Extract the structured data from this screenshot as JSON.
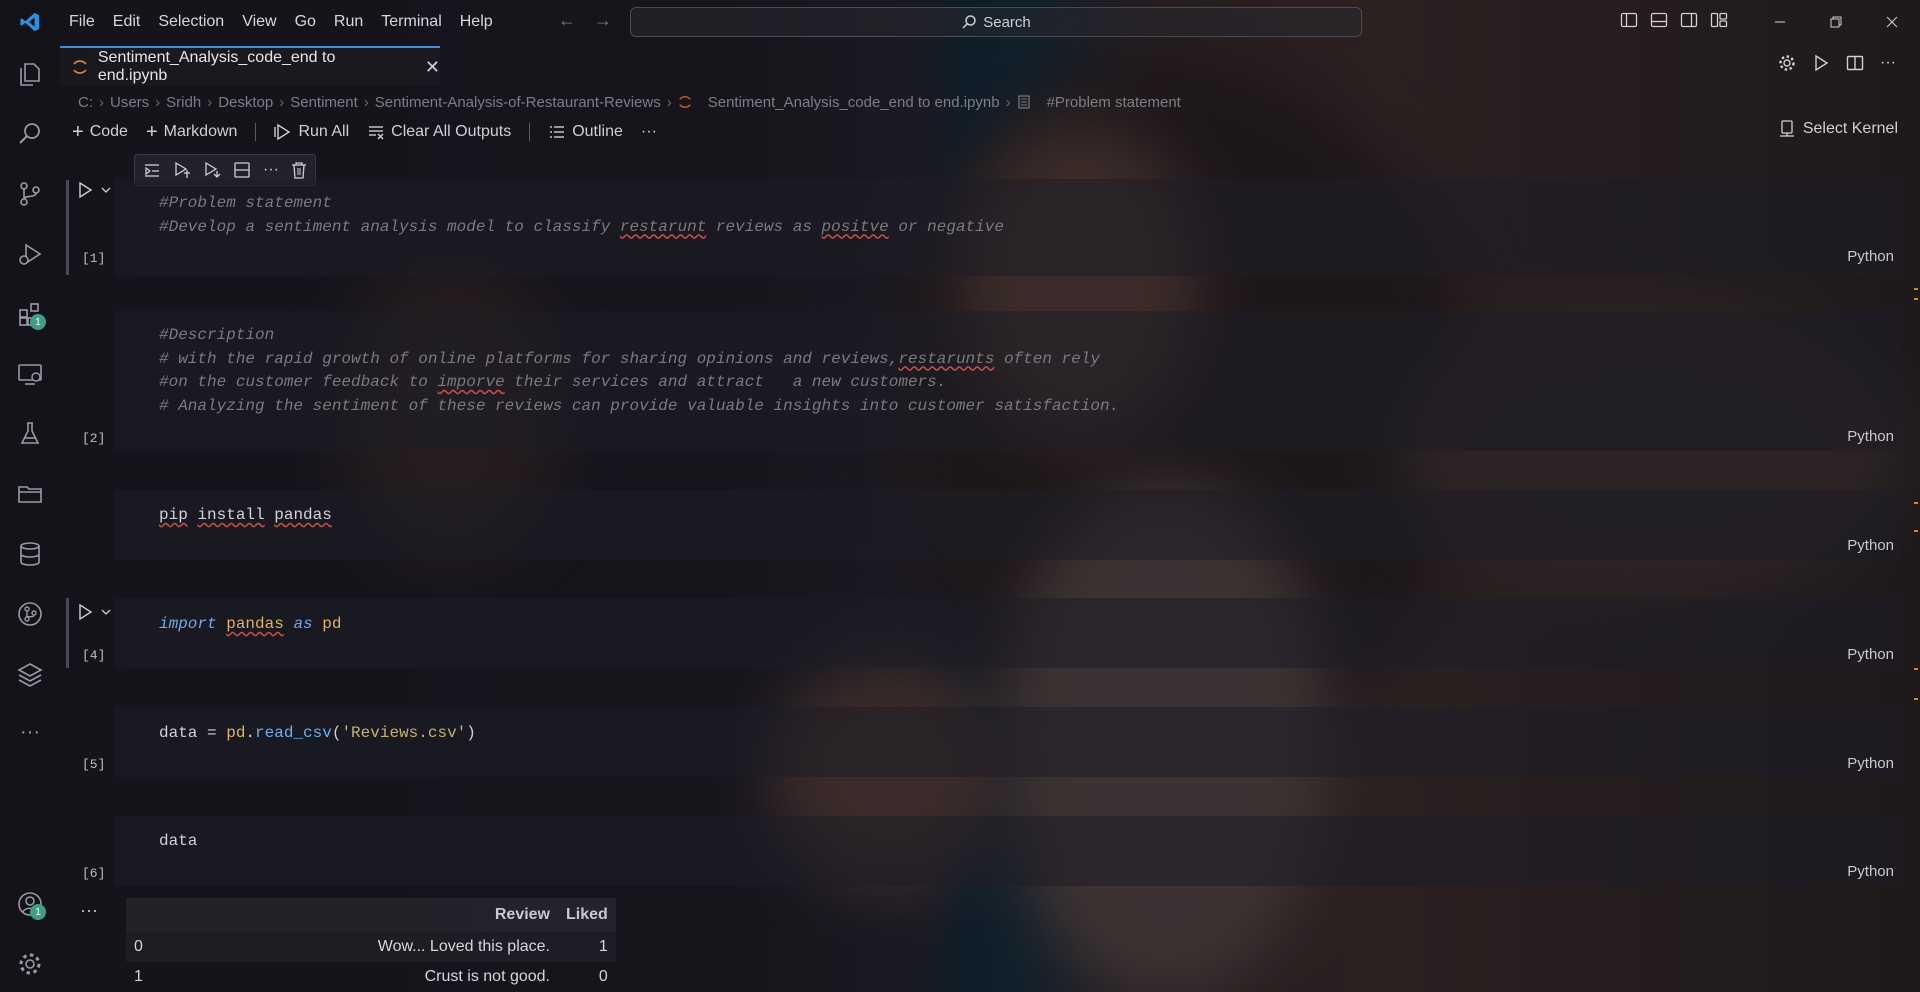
{
  "menu": [
    "File",
    "Edit",
    "Selection",
    "View",
    "Go",
    "Run",
    "Terminal",
    "Help"
  ],
  "search": {
    "placeholder": "Search"
  },
  "activity_badges": {
    "extensions": "1",
    "accounts": "1"
  },
  "tab": {
    "label": "Sentiment_Analysis_code_end to end.ipynb"
  },
  "breadcrumb": [
    "C:",
    "Users",
    "Sridh",
    "Desktop",
    "Sentiment",
    "Sentiment-Analysis-of-Restaurant-Reviews",
    "Sentiment_Analysis_code_end to end.ipynb",
    "#Problem statement"
  ],
  "toolbar": {
    "code": "Code",
    "markdown": "Markdown",
    "run_all": "Run All",
    "clear_outputs": "Clear All Outputs",
    "outline": "Outline",
    "more": "···",
    "kernel": "Select Kernel"
  },
  "cells": [
    {
      "exec": "[1]",
      "lang": "Python",
      "lines": [
        "#Problem statement",
        "#Develop a sentiment analysis model to classify restarunt reviews as positve or negative"
      ]
    },
    {
      "exec": "[2]",
      "lang": "Python",
      "lines": [
        "#Description",
        "# with the rapid growth of online platforms for sharing opinions and reviews,restarunts often rely",
        "#on the customer feedback to imporve their services and attract   a new customers.",
        "# Analyzing the sentiment of these reviews can provide valuable insights into customer satisfaction."
      ]
    },
    {
      "exec": "",
      "lang": "Python",
      "lines": [
        "pip install pandas"
      ]
    },
    {
      "exec": "[4]",
      "lang": "Python",
      "lines": [
        "import pandas as pd"
      ]
    },
    {
      "exec": "[5]",
      "lang": "Python",
      "lines": [
        "data = pd.read_csv('Reviews.csv')"
      ]
    },
    {
      "exec": "[6]",
      "lang": "Python",
      "lines": [
        "data"
      ]
    }
  ],
  "output_more": "···",
  "table": {
    "columns": [
      "",
      "Review",
      "Liked"
    ],
    "rows": [
      [
        "0",
        "Wow... Loved this place.",
        "1"
      ],
      [
        "1",
        "Crust is not good.",
        "0"
      ]
    ]
  },
  "colors": {
    "accent": "#3b8eea",
    "badge": "#3aa08a",
    "keyword": "#75a7e6",
    "module": "#e3b25a",
    "string": "#c6b16e"
  }
}
